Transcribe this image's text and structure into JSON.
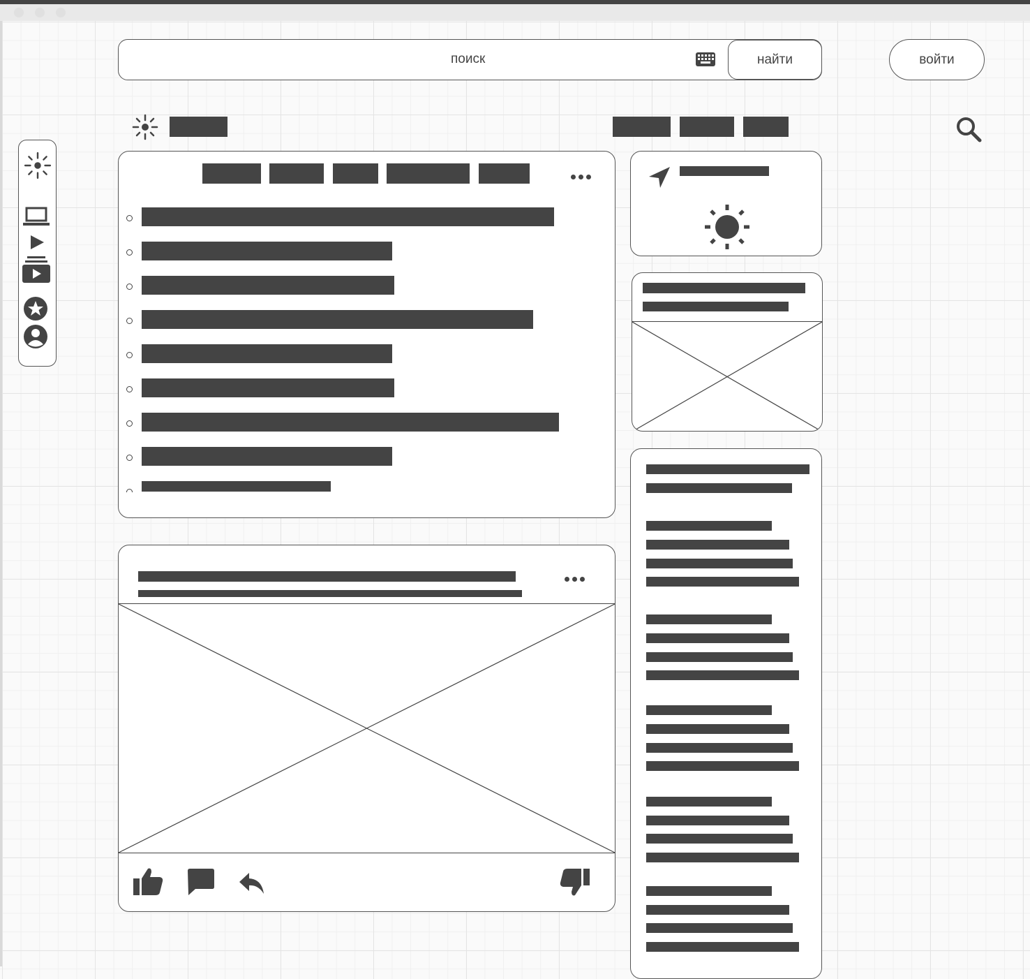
{
  "search": {
    "placeholder": "поиск",
    "button_label": "найти"
  },
  "header": {
    "login_label": "войти"
  },
  "icons": {
    "logo": "sun-logo-icon",
    "keyboard": "keyboard-icon",
    "search": "search-icon",
    "location": "location-arrow-icon",
    "weather": "sun-icon",
    "more": "more-icon",
    "like": "thumbs-up-icon",
    "comment": "comment-icon",
    "share": "reply-icon",
    "dislike": "thumbs-down-icon"
  },
  "sidebar": {
    "items": [
      {
        "icon": "sun-logo-icon"
      },
      {
        "icon": "laptop-icon"
      },
      {
        "icon": "play-icon"
      },
      {
        "icon": "video-playlist-icon"
      },
      {
        "icon": "star-icon"
      },
      {
        "icon": "user-icon"
      }
    ]
  },
  "colors": {
    "placeholder_block": "#444444",
    "border": "#555555",
    "card_background": "#ffffff",
    "grid_background": "#fafafa"
  }
}
